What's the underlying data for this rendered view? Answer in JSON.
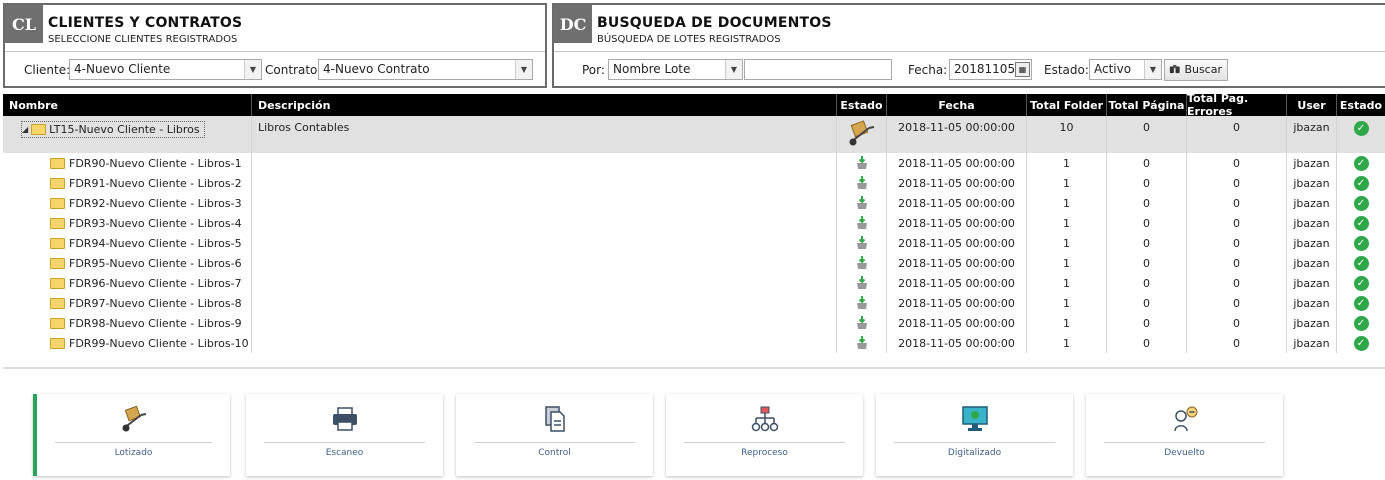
{
  "clientes": {
    "badge": "CL",
    "title": "CLIENTES Y CONTRATOS",
    "subtitle": "SELECCIONE CLIENTES REGISTRADOS",
    "cliente_label": "Cliente:",
    "cliente_value": "4-Nuevo Cliente",
    "contrato_label": "Contrato:",
    "contrato_value": "4-Nuevo Contrato"
  },
  "busqueda": {
    "badge": "DC",
    "title": "BUSQUEDA DE DOCUMENTOS",
    "subtitle": "BÚSQUEDA DE LOTES REGISTRADOS",
    "por_label": "Por:",
    "por_value": "Nombre Lote",
    "search_value": "",
    "fecha_label": "Fecha:",
    "fecha_value": "20181105",
    "estado_label": "Estado:",
    "estado_value": "Activo",
    "buscar_label": "Buscar"
  },
  "grid": {
    "headers": [
      "Nombre",
      "Descripción",
      "Estado",
      "Fecha",
      "Total Folder",
      "Total Página",
      "Total Pag. Errores",
      "User",
      "Estado"
    ],
    "parent": {
      "nombre": "LT15-Nuevo Cliente - Libros",
      "descripcion": "Libros Contables",
      "fecha": "2018-11-05 00:00:00",
      "total_folder": "10",
      "total_pagina": "0",
      "total_errores": "0",
      "user": "jbazan"
    },
    "rows": [
      {
        "nombre": "FDR90-Nuevo Cliente - Libros-1",
        "fecha": "2018-11-05 00:00:00",
        "folder": "1",
        "pagina": "0",
        "errores": "0",
        "user": "jbazan"
      },
      {
        "nombre": "FDR91-Nuevo Cliente - Libros-2",
        "fecha": "2018-11-05 00:00:00",
        "folder": "1",
        "pagina": "0",
        "errores": "0",
        "user": "jbazan"
      },
      {
        "nombre": "FDR92-Nuevo Cliente - Libros-3",
        "fecha": "2018-11-05 00:00:00",
        "folder": "1",
        "pagina": "0",
        "errores": "0",
        "user": "jbazan"
      },
      {
        "nombre": "FDR93-Nuevo Cliente - Libros-4",
        "fecha": "2018-11-05 00:00:00",
        "folder": "1",
        "pagina": "0",
        "errores": "0",
        "user": "jbazan"
      },
      {
        "nombre": "FDR94-Nuevo Cliente - Libros-5",
        "fecha": "2018-11-05 00:00:00",
        "folder": "1",
        "pagina": "0",
        "errores": "0",
        "user": "jbazan"
      },
      {
        "nombre": "FDR95-Nuevo Cliente - Libros-6",
        "fecha": "2018-11-05 00:00:00",
        "folder": "1",
        "pagina": "0",
        "errores": "0",
        "user": "jbazan"
      },
      {
        "nombre": "FDR96-Nuevo Cliente - Libros-7",
        "fecha": "2018-11-05 00:00:00",
        "folder": "1",
        "pagina": "0",
        "errores": "0",
        "user": "jbazan"
      },
      {
        "nombre": "FDR97-Nuevo Cliente - Libros-8",
        "fecha": "2018-11-05 00:00:00",
        "folder": "1",
        "pagina": "0",
        "errores": "0",
        "user": "jbazan"
      },
      {
        "nombre": "FDR98-Nuevo Cliente - Libros-9",
        "fecha": "2018-11-05 00:00:00",
        "folder": "1",
        "pagina": "0",
        "errores": "0",
        "user": "jbazan"
      },
      {
        "nombre": "FDR99-Nuevo Cliente - Libros-10",
        "fecha": "2018-11-05 00:00:00",
        "folder": "1",
        "pagina": "0",
        "errores": "0",
        "user": "jbazan"
      }
    ]
  },
  "stages": [
    {
      "label": "Lotizado",
      "icon": "hand-truck-icon"
    },
    {
      "label": "Escaneo",
      "icon": "printer-scanner-icon"
    },
    {
      "label": "Control",
      "icon": "documents-icon"
    },
    {
      "label": "Reproceso",
      "icon": "hierarchy-icon"
    },
    {
      "label": "Digitalizado",
      "icon": "monitor-icon"
    },
    {
      "label": "Devuelto",
      "icon": "people-minus-icon"
    }
  ],
  "colors": {
    "ok_green": "#2fa84a",
    "active_stage": "#2aa45a",
    "header_bg": "#000000",
    "panel_badge": "#6f6f6f"
  }
}
